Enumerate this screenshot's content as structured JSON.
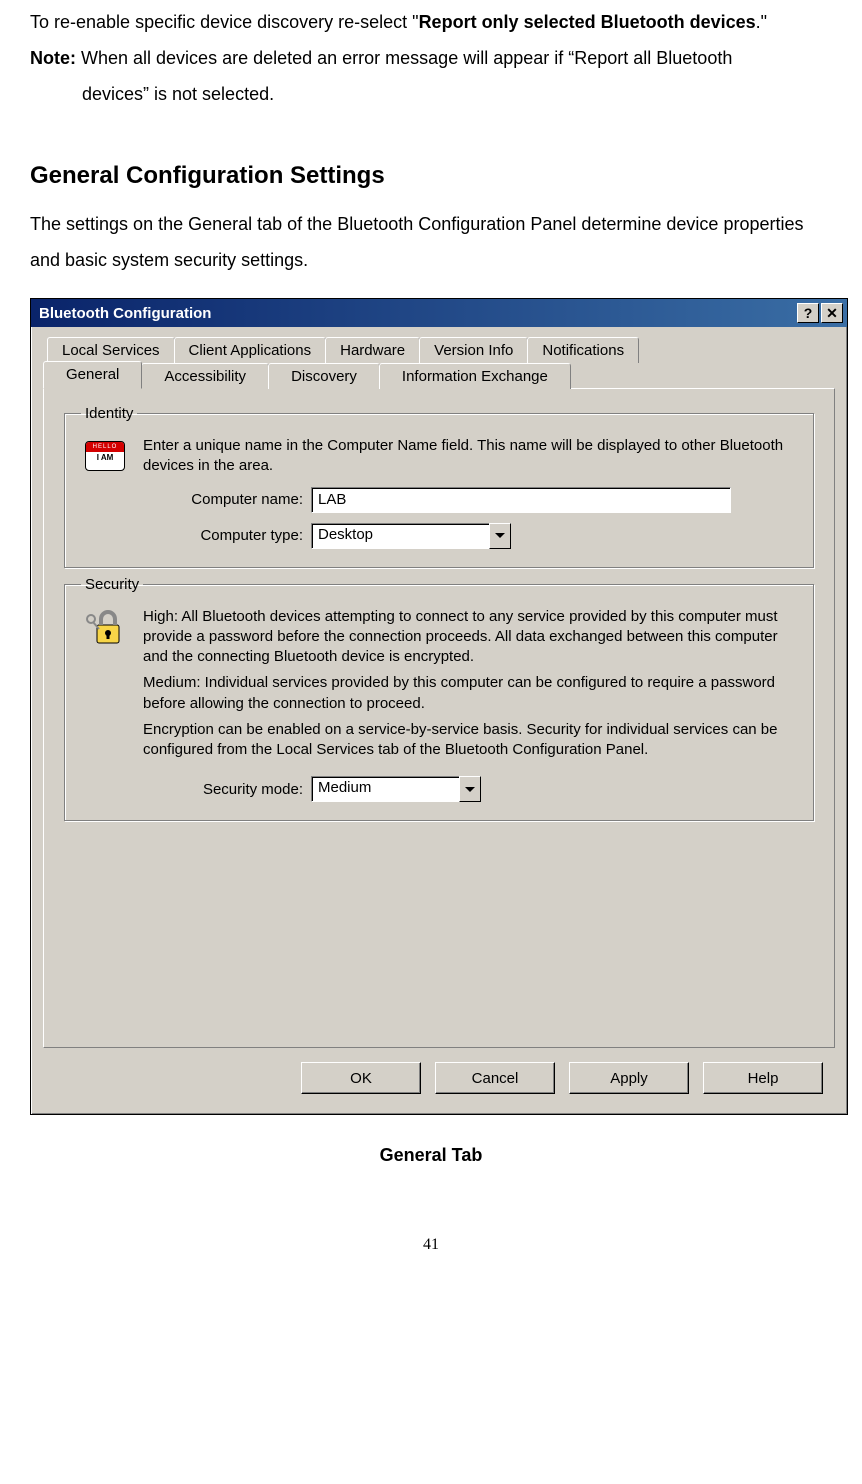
{
  "doc": {
    "line1_prefix": "To re-enable specific device discovery re-select \"",
    "line1_bold": "Report only selected Bluetooth devices",
    "line1_suffix": ".\"",
    "note_label": "Note:",
    "note_text_a": " When all devices are deleted an error message will appear if “Report all Bluetooth",
    "note_text_b": "devices” is not selected.",
    "heading": "General Configuration Settings",
    "para": "The settings on the General tab of the Bluetooth Configuration Panel determine device properties and basic system security settings.",
    "caption": "General Tab",
    "page_number": "41"
  },
  "dialog": {
    "title": "Bluetooth Configuration",
    "help_glyph": "?",
    "close_glyph": "✕",
    "tabs_back": [
      "Local Services",
      "Client Applications",
      "Hardware",
      "Version Info",
      "Notifications"
    ],
    "tabs_front": [
      "General",
      "Accessibility",
      "Discovery",
      "Information Exchange"
    ],
    "active_tab_index": 0,
    "identity": {
      "legend": "Identity",
      "description": "Enter a unique name in the Computer Name field. This name will be displayed to other Bluetooth devices in the area.",
      "name_label": "Computer name:",
      "name_value": "LAB",
      "type_label": "Computer type:",
      "type_value": "Desktop",
      "badge_top": "HELLO",
      "badge_mid": "I AM"
    },
    "security": {
      "legend": "Security",
      "high_text": "High: All Bluetooth devices attempting to connect to any service provided by this computer must provide a password before the connection proceeds. All data exchanged between this computer and the connecting Bluetooth device is encrypted.",
      "medium_text_a": "Medium: Individual services provided by this computer can be configured to require a password before allowing the connection to proceed.",
      "medium_text_b": "Encryption can be enabled on a service-by-service basis. Security for individual services can be configured from the Local Services tab of the Bluetooth Configuration Panel.",
      "mode_label": "Security mode:",
      "mode_value": "Medium"
    },
    "buttons": {
      "ok": "OK",
      "cancel": "Cancel",
      "apply": "Apply",
      "help": "Help"
    }
  }
}
